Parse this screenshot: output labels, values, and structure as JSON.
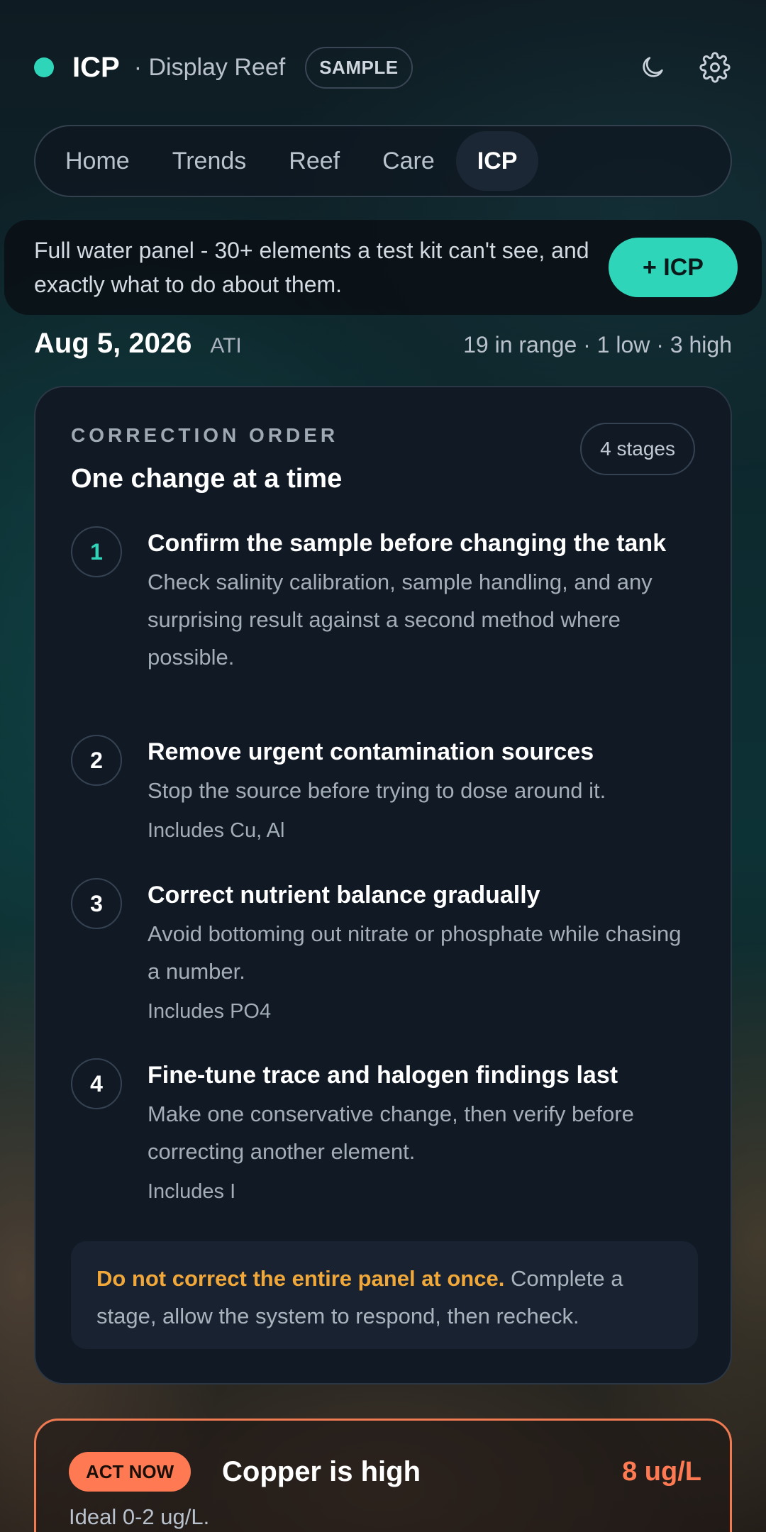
{
  "header": {
    "app_name": "ICP",
    "tank_name": "· Display Reef",
    "sample_badge": "SAMPLE",
    "icons": [
      "moon-icon",
      "gear-icon"
    ],
    "status_color": "#2fd5b8"
  },
  "nav": {
    "tabs": [
      {
        "label": "Home"
      },
      {
        "label": "Trends"
      },
      {
        "label": "Reef"
      },
      {
        "label": "Care"
      },
      {
        "label": "ICP",
        "active": true
      }
    ]
  },
  "banner": {
    "text": "Full water panel - 30+ elements a test kit can't see, and exactly what to do about them.",
    "button_label": "+ ICP"
  },
  "summary": {
    "date": "Aug 5, 2026",
    "lab": "ATI",
    "counts": "19 in range · 1 low · 3 high"
  },
  "correction": {
    "kicker": "CORRECTION ORDER",
    "title": "One change at a time",
    "stages_badge": "4 stages",
    "steps": [
      {
        "number": "1",
        "title": "Confirm the sample before changing the tank",
        "desc": "Check salinity calibration, sample handling, and any surprising result against a second method where possible.",
        "includes": ""
      },
      {
        "number": "2",
        "title": "Remove urgent contamination sources",
        "desc": "Stop the source before trying to dose around it.",
        "includes": "Includes Cu, Al"
      },
      {
        "number": "3",
        "title": "Correct nutrient balance gradually",
        "desc": "Avoid bottoming out nitrate or phosphate while chasing a number.",
        "includes": "Includes PO4"
      },
      {
        "number": "4",
        "title": "Fine-tune trace and halogen findings last",
        "desc": "Make one conservative change, then verify before correcting another element.",
        "includes": "Includes I"
      }
    ],
    "note_strong": "Do not correct the entire panel at once.",
    "note_rest": " Complete a stage, allow the system to respond, then recheck."
  },
  "alert": {
    "badge": "ACT NOW",
    "title": "Copper is high",
    "value": "8 ug/L",
    "ideal": "Ideal 0-2 ug/L.",
    "accent_color": "#ff7a52"
  },
  "colors": {
    "accent": "#2fd5b8",
    "warning": "#f0a83a",
    "danger": "#ff7a52"
  }
}
